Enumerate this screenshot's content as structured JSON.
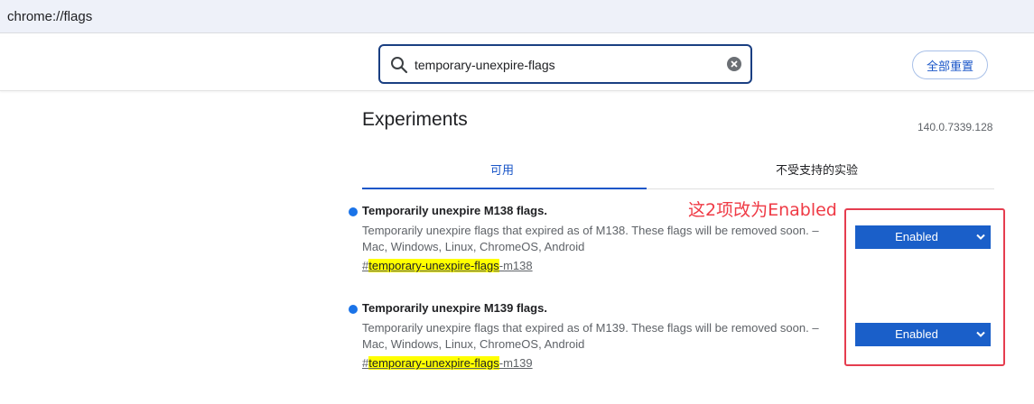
{
  "address_bar": {
    "url": "chrome://flags"
  },
  "search": {
    "value": "temporary-unexpire-flags"
  },
  "header": {
    "reset_all_label": "全部重置"
  },
  "page": {
    "title": "Experiments",
    "version": "140.0.7339.128"
  },
  "tabs": [
    {
      "label": "可用",
      "selected": true
    },
    {
      "label": "不受支持的实验",
      "selected": false
    }
  ],
  "experiments": [
    {
      "name": "Temporarily unexpire M138 flags.",
      "description": "Temporarily unexpire flags that expired as of M138. These flags will be removed soon. – Mac, Windows, Linux, ChromeOS, Android",
      "link_prefix": "#",
      "link_match": "temporary-unexpire-flags",
      "link_suffix": "-m138",
      "state": "Enabled"
    },
    {
      "name": "Temporarily unexpire M139 flags.",
      "description": "Temporarily unexpire flags that expired as of M139. These flags will be removed soon. – Mac, Windows, Linux, ChromeOS, Android",
      "link_prefix": "#",
      "link_match": "temporary-unexpire-flags",
      "link_suffix": "-m139",
      "state": "Enabled"
    }
  ],
  "annotation": {
    "text": "这2项改为Enabled",
    "color": "#e53d4f"
  },
  "colors": {
    "accent": "#1a56c8",
    "select_bg": "#1a5fc9",
    "highlight": "#ffff00"
  }
}
